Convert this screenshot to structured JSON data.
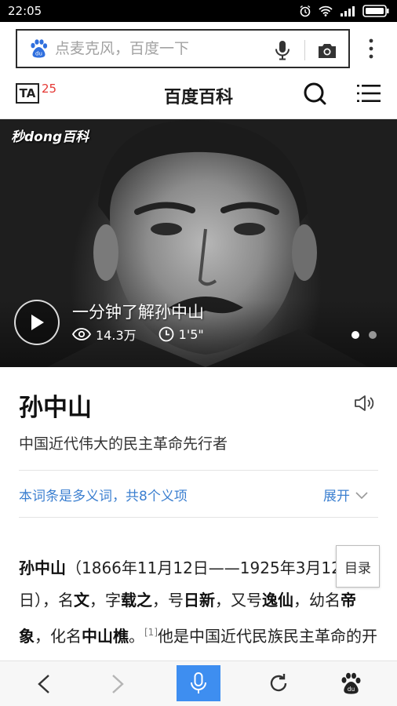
{
  "status_bar": {
    "time": "22:05",
    "icons": [
      "alarm-icon",
      "wifi-icon",
      "signal-icon",
      "battery-icon"
    ]
  },
  "search": {
    "placeholder": "点麦克风，百度一下"
  },
  "header": {
    "ta_label": "TA",
    "ta_count": "25",
    "title": "百度百科"
  },
  "hero": {
    "watermark": "秒dong百科",
    "video_title": "一分钟了解孙中山",
    "views": "14.3万",
    "duration": "1'5\""
  },
  "entry": {
    "name": "孙中山",
    "description": "中国近代伟大的民主革命先行者",
    "polysemy_notice": "本词条是多义词，共8个义项",
    "expand_label": "展开"
  },
  "body": {
    "segments": [
      {
        "text": "孙中山",
        "bold": true
      },
      {
        "text": "（1866年11月12日——1925年3月12日），名",
        "bold": false
      },
      {
        "text": "文",
        "bold": true
      },
      {
        "text": "，字",
        "bold": false
      },
      {
        "text": "载之",
        "bold": true
      },
      {
        "text": "，号",
        "bold": false
      },
      {
        "text": "日新",
        "bold": true
      },
      {
        "text": "，又号",
        "bold": false
      },
      {
        "text": "逸仙",
        "bold": true
      },
      {
        "text": "，幼名",
        "bold": false
      },
      {
        "text": "帝象",
        "bold": true
      },
      {
        "text": "，化名",
        "bold": false
      },
      {
        "text": "中山樵",
        "bold": true
      },
      {
        "text": "。",
        "bold": false
      },
      {
        "text": "[1]",
        "sup": true
      },
      {
        "text": "他是中国近代民族民主革命的开拓者，中国",
        "bold": false
      }
    ],
    "toc_label": "目录"
  },
  "bottom_nav": [
    "back-icon",
    "forward-icon",
    "voice-search-icon",
    "refresh-icon",
    "baidu-home-icon"
  ],
  "colors": {
    "link": "#3b7fd0",
    "voice_button": "#3e8ef0",
    "badge_count": "#e53935",
    "baidu_blue": "#2f6fde"
  }
}
